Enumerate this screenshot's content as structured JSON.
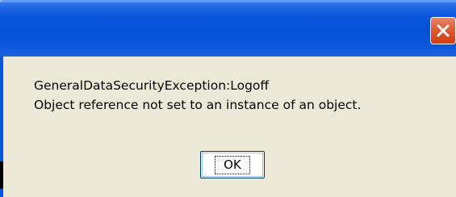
{
  "dialog": {
    "title": "",
    "message_lines": [
      "GeneralDataSecurityException:Logoff",
      "Object reference not set to an instance of an object."
    ],
    "ok_label": "OK",
    "close_icon": "close-icon"
  },
  "colors": {
    "titlebar": "#0a55dd",
    "close_button": "#e05a33",
    "body_background": "#ece9d8",
    "button_border": "#003c74"
  }
}
